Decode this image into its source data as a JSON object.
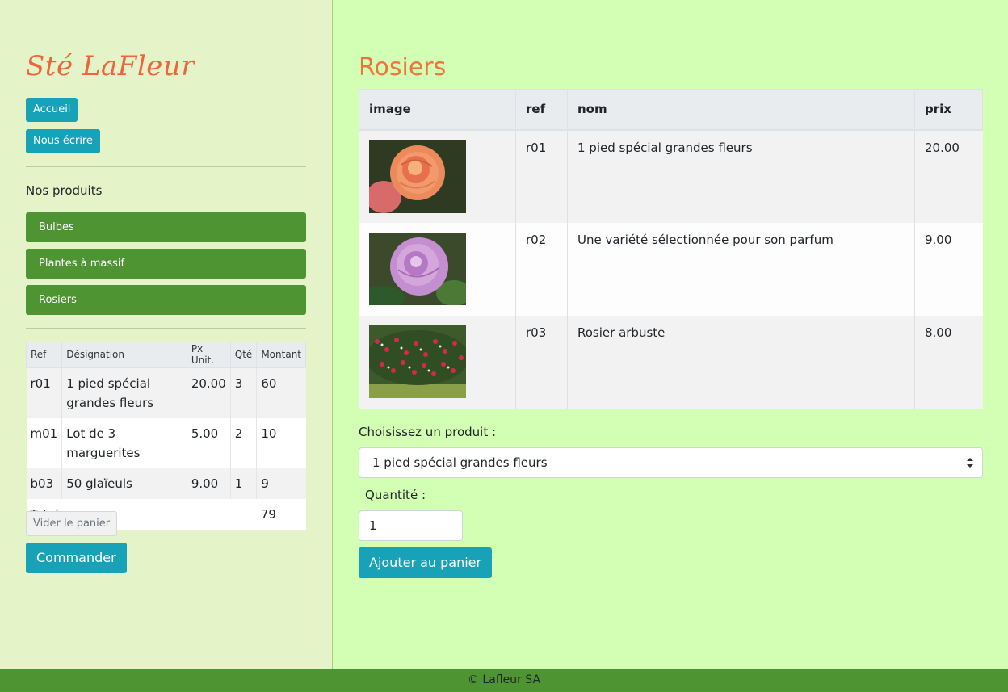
{
  "sidebar": {
    "brand": "Sté LaFleur",
    "nav": {
      "home": "Accueil",
      "contact": "Nous écrire"
    },
    "products_label": "Nos produits",
    "categories": [
      "Bulbes",
      "Plantes à massif",
      "Rosiers"
    ],
    "cart": {
      "headers": [
        "Ref",
        "Désignation",
        "Px Unit.",
        "Qté",
        "Montant"
      ],
      "rows": [
        {
          "ref": "r01",
          "designation": "1 pied spécial grandes fleurs",
          "unit_price": "20.00",
          "qty": "3",
          "amount": "60"
        },
        {
          "ref": "m01",
          "designation": "Lot de 3 marguerites",
          "unit_price": "5.00",
          "qty": "2",
          "amount": "10"
        },
        {
          "ref": "b03",
          "designation": "50 glaïeuls",
          "unit_price": "9.00",
          "qty": "1",
          "amount": "9"
        }
      ],
      "total_label": "Total :",
      "total_value": "79"
    },
    "empty_cart_label": "Vider le panier",
    "order_label": "Commander"
  },
  "main": {
    "title": "Rosiers",
    "table": {
      "headers": [
        "image",
        "ref",
        "nom",
        "prix"
      ],
      "rows": [
        {
          "ref": "r01",
          "name": "1 pied spécial grandes fleurs",
          "price": "20.00",
          "image": "orange-rose-photo"
        },
        {
          "ref": "r02",
          "name": "Une variété sélectionnée pour son parfum",
          "price": "9.00",
          "image": "lilac-rose-photo"
        },
        {
          "ref": "r03",
          "name": "Rosier arbuste",
          "price": "8.00",
          "image": "shrub-rose-photo"
        }
      ]
    },
    "choose_label": "Choisissez un produit :",
    "select_value": "1 pied spécial grandes fleurs",
    "qty_label": "Quantité :",
    "qty_value": "1",
    "add_label": "Ajouter au panier"
  },
  "footer": {
    "text": "© Lafleur SA"
  }
}
